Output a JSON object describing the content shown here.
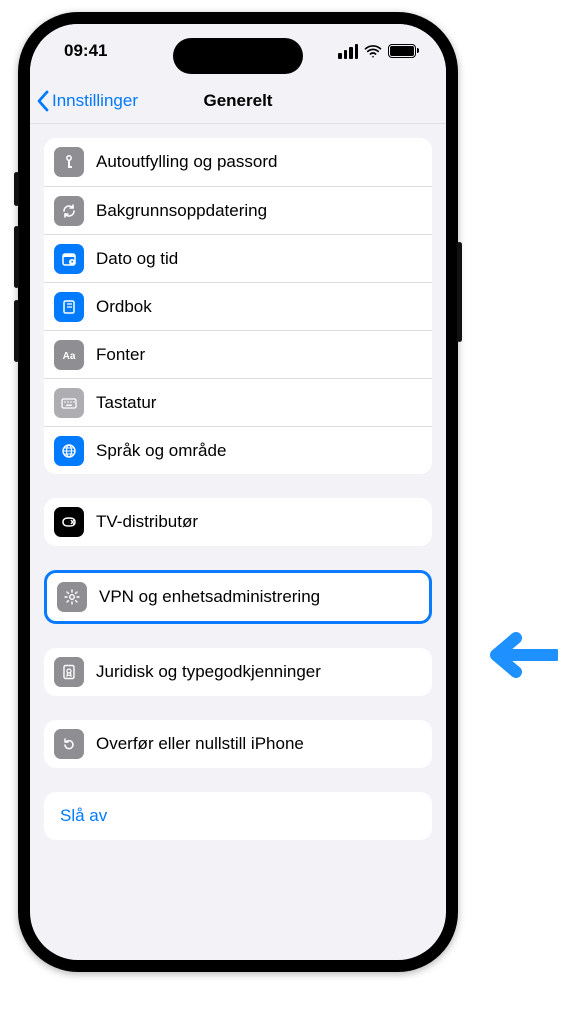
{
  "status": {
    "time": "09:41"
  },
  "nav": {
    "back": "Innstillinger",
    "title": "Generelt"
  },
  "groups": [
    {
      "rows": [
        {
          "icon": "key-icon",
          "bg": "ic-gray",
          "label": "Autoutfylling og passord"
        },
        {
          "icon": "refresh-icon",
          "bg": "ic-gray",
          "label": "Bakgrunnsoppdatering"
        },
        {
          "icon": "calendar-icon",
          "bg": "ic-blue",
          "label": "Dato og tid"
        },
        {
          "icon": "book-icon",
          "bg": "ic-blue",
          "label": "Ordbok"
        },
        {
          "icon": "fonts-icon",
          "bg": "ic-gray",
          "label": "Fonter"
        },
        {
          "icon": "keyboard-icon",
          "bg": "ic-gray2",
          "label": "Tastatur"
        },
        {
          "icon": "globe-icon",
          "bg": "ic-blue",
          "label": "Språk og område"
        }
      ]
    },
    {
      "rows": [
        {
          "icon": "tv-icon",
          "bg": "ic-black",
          "label": "TV-distributør"
        }
      ]
    },
    {
      "highlighted": true,
      "rows": [
        {
          "icon": "gear-icon",
          "bg": "ic-gray",
          "label": "VPN og enhetsadministrering"
        }
      ]
    },
    {
      "rows": [
        {
          "icon": "cert-icon",
          "bg": "ic-gray",
          "label": "Juridisk og typegodkjenninger"
        }
      ]
    },
    {
      "rows": [
        {
          "icon": "reset-icon",
          "bg": "ic-gray",
          "label": "Overfør eller nullstill iPhone"
        }
      ]
    }
  ],
  "shutdown": "Slå av"
}
